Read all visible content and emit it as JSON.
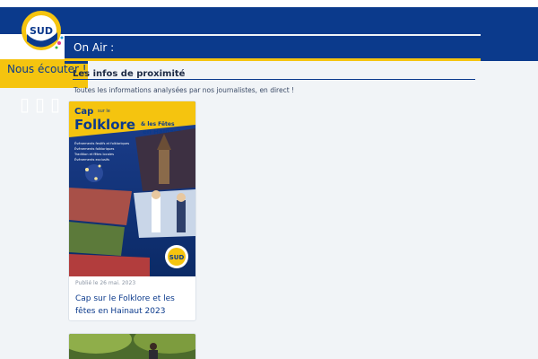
{
  "header": {
    "on_air_label": "On Air :",
    "listen_label": "Nous écouter !",
    "player_glyphs": "▯▯▯",
    "brand_color": "#0b3a8c",
    "accent_color": "#f5c40f"
  },
  "logo": {
    "text": "SUD",
    "icon": "sud-radio-logo"
  },
  "section": {
    "title": "Les infos de proximité",
    "subtitle": "Toutes les informations analysées par nos journalistes, en direct !"
  },
  "articles": [
    {
      "image_text": {
        "line1": "Cap",
        "line2": "sur le",
        "line3": "Folklore",
        "line4": "& les Fêtes",
        "line5": "en Hainaut",
        "bullets": [
          "Événements festifs et folkloriques",
          "Événements folkloriques",
          "Tradition et fêtes locales",
          "Événements exclusifs"
        ]
      },
      "date": "Publié le 26 mai. 2023",
      "title": "Cap sur le Folklore et les fêtes en Hainaut 2023"
    },
    {
      "title": ""
    }
  ]
}
